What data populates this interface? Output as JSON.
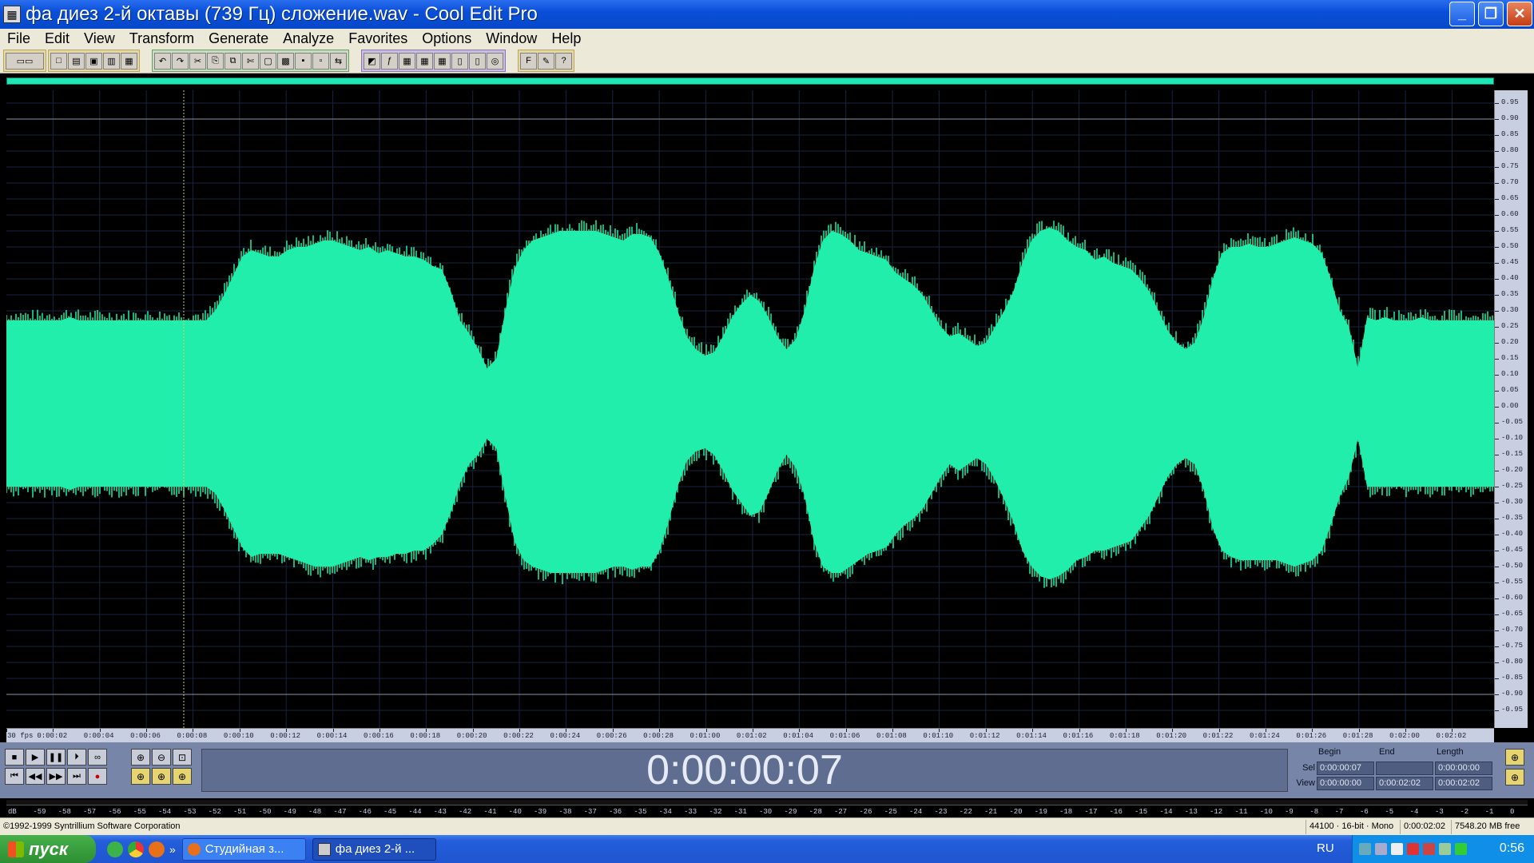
{
  "window": {
    "title": "фа диез 2-й октавы (739 Гц) сложение.wav - Cool Edit Pro",
    "minimize_label": "_",
    "maximize_label": "❐",
    "close_label": "✕"
  },
  "menu": [
    "File",
    "Edit",
    "View",
    "Transform",
    "Generate",
    "Analyze",
    "Favorites",
    "Options",
    "Window",
    "Help"
  ],
  "amp_ruler": {
    "labels": [
      "0.95",
      "0.90",
      "0.85",
      "0.80",
      "0.75",
      "0.70",
      "0.65",
      "0.60",
      "0.55",
      "0.50",
      "0.45",
      "0.40",
      "0.35",
      "0.30",
      "0.25",
      "0.20",
      "0.15",
      "0.10",
      "0.05",
      "0.00",
      "-0.05",
      "-0.10",
      "-0.15",
      "-0.20",
      "-0.25",
      "-0.30",
      "-0.35",
      "-0.40",
      "-0.45",
      "-0.50",
      "-0.55",
      "-0.60",
      "-0.65",
      "-0.70",
      "-0.75",
      "-0.80",
      "-0.85",
      "-0.90",
      "-0.95"
    ]
  },
  "time_ruler": {
    "labels": [
      "30 fps",
      "0:00:02",
      "0:00:04",
      "0:00:06",
      "0:00:08",
      "0:00:10",
      "0:00:12",
      "0:00:14",
      "0:00:16",
      "0:00:18",
      "0:00:20",
      "0:00:22",
      "0:00:24",
      "0:00:26",
      "0:00:28",
      "0:01:00",
      "0:01:02",
      "0:01:04",
      "0:01:06",
      "0:01:08",
      "0:01:10",
      "0:01:12",
      "0:01:14",
      "0:01:16",
      "0:01:18",
      "0:01:20",
      "0:01:22",
      "0:01:24",
      "0:01:26",
      "0:01:28",
      "0:02:00",
      "0:02:02"
    ]
  },
  "waveform": {
    "color": "#20eeaa",
    "background": "#000000",
    "cursor_color": "#d8d060",
    "cursor_time": "0:00:00:07",
    "envelope_upper": [
      0.27,
      0.27,
      0.27,
      0.27,
      0.27,
      0.27,
      0.27,
      0.28,
      0.27,
      0.27,
      0.27,
      0.27,
      0.27,
      0.27,
      0.27,
      0.27,
      0.27,
      0.27,
      0.27,
      0.27,
      0.27,
      0.27,
      0.27,
      0.3,
      0.35,
      0.41,
      0.47,
      0.49,
      0.48,
      0.47,
      0.47,
      0.49,
      0.5,
      0.5,
      0.51,
      0.52,
      0.52,
      0.51,
      0.5,
      0.49,
      0.5,
      0.48,
      0.49,
      0.48,
      0.47,
      0.47,
      0.46,
      0.44,
      0.43,
      0.36,
      0.27,
      0.23,
      0.18,
      0.12,
      0.15,
      0.3,
      0.43,
      0.49,
      0.52,
      0.53,
      0.54,
      0.55,
      0.55,
      0.55,
      0.55,
      0.55,
      0.54,
      0.53,
      0.52,
      0.54,
      0.54,
      0.53,
      0.48,
      0.4,
      0.3,
      0.22,
      0.18,
      0.16,
      0.17,
      0.22,
      0.28,
      0.32,
      0.35,
      0.33,
      0.28,
      0.22,
      0.18,
      0.21,
      0.3,
      0.43,
      0.52,
      0.55,
      0.54,
      0.52,
      0.49,
      0.48,
      0.47,
      0.46,
      0.42,
      0.4,
      0.38,
      0.35,
      0.3,
      0.25,
      0.22,
      0.23,
      0.21,
      0.19,
      0.2,
      0.25,
      0.3,
      0.36,
      0.45,
      0.52,
      0.55,
      0.56,
      0.55,
      0.52,
      0.5,
      0.49,
      0.46,
      0.47,
      0.45,
      0.44,
      0.43,
      0.4,
      0.36,
      0.3,
      0.24,
      0.2,
      0.18,
      0.2,
      0.28,
      0.4,
      0.48,
      0.5,
      0.5,
      0.51,
      0.5,
      0.5,
      0.51,
      0.52,
      0.53,
      0.52,
      0.51,
      0.48,
      0.4,
      0.3,
      0.25,
      0.12,
      0.28,
      0.27,
      0.28,
      0.27,
      0.27,
      0.27,
      0.28,
      0.27,
      0.27,
      0.27,
      0.27,
      0.27,
      0.27,
      0.27,
      0.27
    ],
    "envelope_lower": [
      -0.25,
      -0.25,
      -0.25,
      -0.25,
      -0.25,
      -0.25,
      -0.25,
      -0.26,
      -0.25,
      -0.25,
      -0.25,
      -0.25,
      -0.25,
      -0.25,
      -0.25,
      -0.25,
      -0.25,
      -0.25,
      -0.25,
      -0.25,
      -0.25,
      -0.25,
      -0.25,
      -0.27,
      -0.32,
      -0.38,
      -0.44,
      -0.47,
      -0.46,
      -0.46,
      -0.46,
      -0.47,
      -0.48,
      -0.49,
      -0.5,
      -0.5,
      -0.5,
      -0.49,
      -0.48,
      -0.47,
      -0.48,
      -0.47,
      -0.47,
      -0.46,
      -0.46,
      -0.45,
      -0.45,
      -0.43,
      -0.4,
      -0.33,
      -0.24,
      -0.18,
      -0.15,
      -0.1,
      -0.13,
      -0.28,
      -0.42,
      -0.48,
      -0.5,
      -0.51,
      -0.52,
      -0.52,
      -0.52,
      -0.52,
      -0.52,
      -0.52,
      -0.51,
      -0.5,
      -0.5,
      -0.51,
      -0.5,
      -0.5,
      -0.45,
      -0.36,
      -0.25,
      -0.17,
      -0.14,
      -0.13,
      -0.15,
      -0.2,
      -0.26,
      -0.3,
      -0.34,
      -0.33,
      -0.27,
      -0.2,
      -0.15,
      -0.19,
      -0.28,
      -0.42,
      -0.5,
      -0.52,
      -0.52,
      -0.5,
      -0.48,
      -0.46,
      -0.45,
      -0.44,
      -0.4,
      -0.37,
      -0.35,
      -0.32,
      -0.27,
      -0.22,
      -0.18,
      -0.2,
      -0.18,
      -0.16,
      -0.18,
      -0.23,
      -0.29,
      -0.36,
      -0.45,
      -0.5,
      -0.53,
      -0.54,
      -0.53,
      -0.51,
      -0.48,
      -0.47,
      -0.45,
      -0.45,
      -0.44,
      -0.43,
      -0.42,
      -0.38,
      -0.34,
      -0.28,
      -0.22,
      -0.18,
      -0.16,
      -0.18,
      -0.26,
      -0.38,
      -0.45,
      -0.47,
      -0.48,
      -0.48,
      -0.48,
      -0.48,
      -0.48,
      -0.49,
      -0.5,
      -0.49,
      -0.48,
      -0.45,
      -0.37,
      -0.28,
      -0.22,
      -0.1,
      -0.25,
      -0.25,
      -0.25,
      -0.25,
      -0.25,
      -0.25,
      -0.25,
      -0.25,
      -0.25,
      -0.25,
      -0.25,
      -0.25,
      -0.25,
      -0.25,
      -0.25
    ]
  },
  "transport": {
    "row1": [
      "■",
      "▶",
      "❚❚",
      "⏵",
      "∞"
    ],
    "row2": [
      "⏮",
      "◀◀",
      "▶▶",
      "⏭",
      "●"
    ]
  },
  "zoom": {
    "buttons": [
      "⊕",
      "⊖",
      "⊡",
      "⊕",
      "⊕",
      "⊕"
    ],
    "right": [
      "⊕",
      "⊕"
    ]
  },
  "time_display": "0:00:00:07",
  "selview": {
    "headers": [
      "Begin",
      "End",
      "Length"
    ],
    "sel_label": "Sel",
    "view_label": "View",
    "sel": [
      "0:00:00:07",
      "",
      "0:00:00:00"
    ],
    "view": [
      "0:00:00:00",
      "0:00:02:02",
      "0:00:02:02"
    ]
  },
  "level_meter": {
    "labels": [
      "dB",
      "-59",
      "-58",
      "-57",
      "-56",
      "-55",
      "-54",
      "-53",
      "-52",
      "-51",
      "-50",
      "-49",
      "-48",
      "-47",
      "-46",
      "-45",
      "-44",
      "-43",
      "-42",
      "-41",
      "-40",
      "-39",
      "-38",
      "-37",
      "-36",
      "-35",
      "-34",
      "-33",
      "-32",
      "-31",
      "-30",
      "-29",
      "-28",
      "-27",
      "-26",
      "-25",
      "-24",
      "-23",
      "-22",
      "-21",
      "-20",
      "-19",
      "-18",
      "-17",
      "-16",
      "-15",
      "-14",
      "-13",
      "-12",
      "-11",
      "-10",
      "-9",
      "-8",
      "-7",
      "-6",
      "-5",
      "-4",
      "-3",
      "-2",
      "-1",
      "0"
    ]
  },
  "statusbar": {
    "copyright": "©1992-1999 Syntrillium Software Corporation",
    "format": "44100 · 16-bit · Mono",
    "duration": "0:00:02:02",
    "free": "7548.20 MB free"
  },
  "taskbar": {
    "start_label": "пуск",
    "tasks": [
      {
        "label": "Студийная з...",
        "active": false
      },
      {
        "label": "фа диез 2-й ...",
        "active": true
      }
    ],
    "quick_launch_more": "»",
    "lang": "RU",
    "clock": "0:56"
  },
  "colors": {
    "titlebar": "#0a4fd8",
    "menubar": "#ece9d8",
    "panel": "#7786a8",
    "wave": "#20eeaa"
  }
}
